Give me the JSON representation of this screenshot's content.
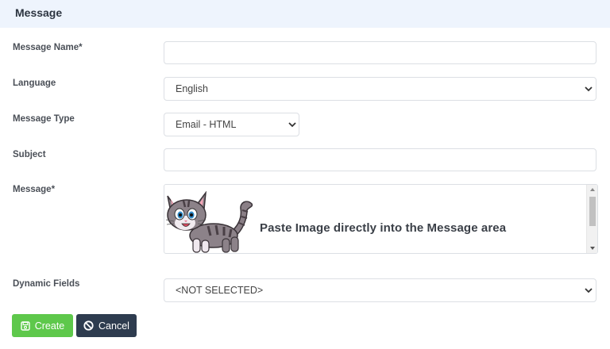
{
  "header": {
    "title": "Message"
  },
  "form": {
    "message_name": {
      "label": "Message Name*",
      "value": ""
    },
    "language": {
      "label": "Language",
      "selected": "English"
    },
    "message_type": {
      "label": "Message Type",
      "selected": "Email - HTML"
    },
    "subject": {
      "label": "Subject",
      "value": ""
    },
    "message": {
      "label": "Message*",
      "editor_text": "Paste Image directly into the Message area"
    },
    "dynamic_fields": {
      "label": "Dynamic Fields",
      "selected": "<NOT SELECTED>"
    }
  },
  "actions": {
    "create_label": "Create",
    "cancel_label": "Cancel"
  },
  "colors": {
    "create": "#5ec84b",
    "cancel": "#2e3c4f",
    "header_bg": "#eef4fd"
  },
  "icons": [
    "save-icon",
    "cancel-circle-icon",
    "chevron-down-icon",
    "cat-illustration"
  ]
}
